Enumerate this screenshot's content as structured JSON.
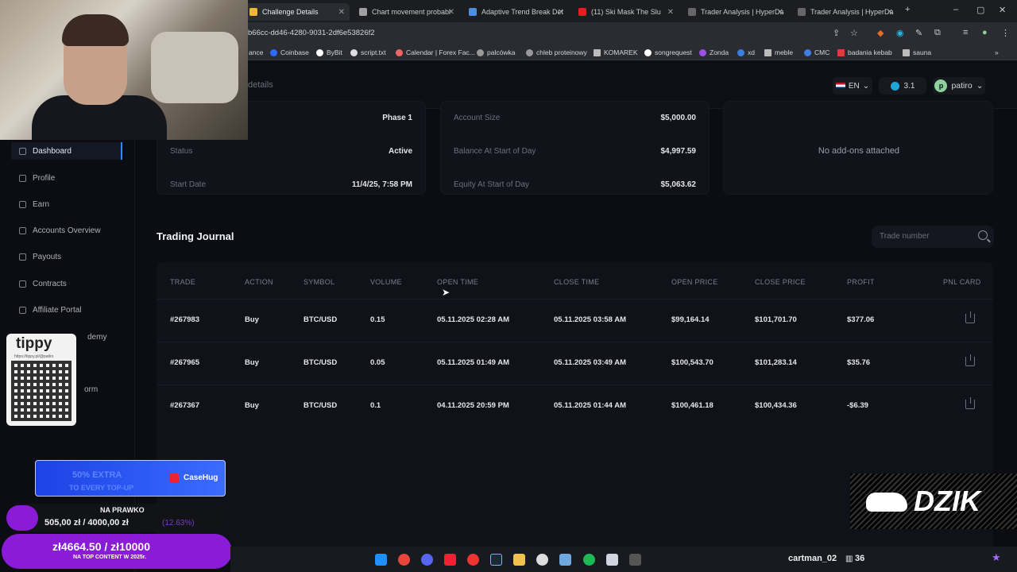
{
  "browser": {
    "tabs": [
      {
        "label": "Challenge Details",
        "active": true,
        "fav": "#f2b731"
      },
      {
        "label": "Chart movement probabi",
        "fav": "#a0a0a0"
      },
      {
        "label": "Adaptive Trend Break Det",
        "fav": "#4a90e2"
      },
      {
        "label": "(11) Ski Mask The Slu",
        "fav": "#e02020"
      },
      {
        "label": "Trader Analysis | HyperDa",
        "fav": "#666"
      },
      {
        "label": "Trader Analysis | HyperDa",
        "fav": "#666"
      }
    ],
    "url": "b66cc-dd46-4280-9031-2df6e53826f2",
    "bookmarks": [
      "ance",
      "Coinbase",
      "ByBit",
      "script.txt",
      "Calendar | Forex Fac...",
      "palcówka",
      "chleb proteinowy",
      "KOMAREK",
      "songrequest",
      "Zonda",
      "xd",
      "meble",
      "CMC",
      "badania kebab",
      "sauna"
    ]
  },
  "header": {
    "crumb": "details",
    "lang": "EN",
    "coins": "3.1",
    "user": "patiro",
    "avatar_letter": "p"
  },
  "sidebar": {
    "items": [
      "Dashboard",
      "Profile",
      "Earn",
      "Accounts Overview",
      "Payouts",
      "Contracts",
      "Affiliate Portal",
      "demy",
      "orm"
    ]
  },
  "challenge": {
    "phase": "Phase 1",
    "status_label": "Status",
    "status": "Active",
    "start_label": "Start Date",
    "start": "11/4/25, 7:58 PM"
  },
  "account": {
    "size_label": "Account Size",
    "size": "$5,000.00",
    "balance_label": "Balance At Start of Day",
    "balance": "$4,997.59",
    "equity_label": "Equity At Start of Day",
    "equity": "$5,063.62"
  },
  "addons": {
    "empty": "No add-ons attached"
  },
  "journal": {
    "title": "Trading Journal",
    "search_placeholder": "Trade number",
    "columns": [
      "TRADE",
      "ACTION",
      "SYMBOL",
      "VOLUME",
      "OPEN TIME",
      "CLOSE TIME",
      "OPEN PRICE",
      "CLOSE PRICE",
      "PROFIT",
      "PNL CARD"
    ],
    "rows": [
      {
        "trade": "#267983",
        "action": "Buy",
        "symbol": "BTC/USD",
        "volume": "0.15",
        "open_time": "05.11.2025 02:28 AM",
        "close_time": "05.11.2025 03:58 AM",
        "open_price": "$99,164.14",
        "close_price": "$101,701.70",
        "profit": "$377.06"
      },
      {
        "trade": "#267965",
        "action": "Buy",
        "symbol": "BTC/USD",
        "volume": "0.05",
        "open_time": "05.11.2025 01:49 AM",
        "close_time": "05.11.2025 03:49 AM",
        "open_price": "$100,543.70",
        "close_price": "$101,283.14",
        "profit": "$35.76"
      },
      {
        "trade": "#267367",
        "action": "Buy",
        "symbol": "BTC/USD",
        "volume": "0.1",
        "open_time": "04.11.2025 20:59 PM",
        "close_time": "05.11.2025 01:44 AM",
        "open_price": "$100,461.18",
        "close_price": "$100,434.36",
        "profit": "-$6.39"
      }
    ]
  },
  "overlay": {
    "tippy": "tippy",
    "tippy_url": "https://tippy.pl/@patiro",
    "promo_line1": "50% EXTRA",
    "promo_line2": "TO EVERY TOP-UP",
    "promo_brand": "CaseHug",
    "goal1_title": "NA PRAWKO",
    "goal1_value": "505,00 zł / 4000,00 zł",
    "goal1_pct": "(12.63%)",
    "goal2_value": "zł4664.50 / zł10000",
    "goal2_sub": "NA TOP CONTENT W 2025r.",
    "dzik": "DZIK",
    "viewer": "cartman_02",
    "viewer_count": "36"
  }
}
